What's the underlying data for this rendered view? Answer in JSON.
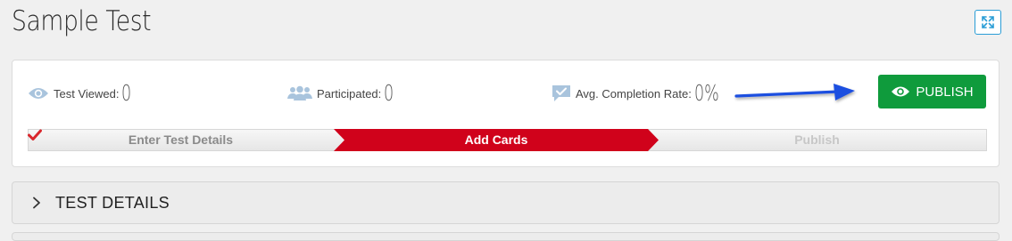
{
  "page": {
    "title": "Sample Test"
  },
  "stats": {
    "viewed": {
      "label": "Test Viewed:",
      "value": "0"
    },
    "participated": {
      "label": "Participated:",
      "value": "0"
    },
    "completion": {
      "label": "Avg. Completion Rate:",
      "value": "0%"
    }
  },
  "publish_button": {
    "label": "PUBLISH"
  },
  "steps": [
    {
      "label": "Enter Test Details",
      "state": "completed"
    },
    {
      "label": "Add Cards",
      "state": "active"
    },
    {
      "label": "Publish",
      "state": "pending"
    }
  ],
  "sections": [
    {
      "title": "TEST DETAILS",
      "expanded": false
    }
  ],
  "colors": {
    "accent_blue": "#2a9dd6",
    "publish_green": "#0f9b3c",
    "step_active_red": "#d0021b",
    "check_red": "#d9262c",
    "annotation_arrow": "#1f4fe0"
  },
  "icons": {
    "expand": "expand-icon",
    "viewed": "eye-icon",
    "participated": "users-icon",
    "completion": "chat-check-icon",
    "publish": "eye-icon",
    "step_done": "checkmark-icon",
    "section": "chevron-right-icon"
  }
}
